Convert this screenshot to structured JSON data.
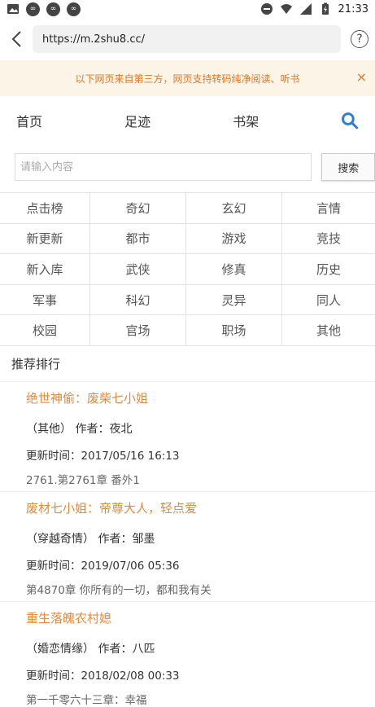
{
  "status": {
    "time": "21:33"
  },
  "browser": {
    "url": "https://m.2shu8.cc/"
  },
  "notice": {
    "text": "以下网页来自第三方，网页支持转码纯净阅读、听书",
    "close": "×"
  },
  "nav": {
    "items": [
      "首页",
      "足迹",
      "书架"
    ]
  },
  "search": {
    "placeholder": "请输入内容",
    "button": "搜索"
  },
  "categories": [
    "点击榜",
    "奇幻",
    "玄幻",
    "言情",
    "新更新",
    "都市",
    "游戏",
    "竞技",
    "新入库",
    "武侠",
    "修真",
    "历史",
    "军事",
    "科幻",
    "灵异",
    "同人",
    "校园",
    "官场",
    "职场",
    "其他"
  ],
  "recommend": {
    "header": "推荐排行",
    "books": [
      {
        "title": "绝世神偷：废柴七小姐",
        "meta": "（其他） 作者：夜北",
        "time": "更新时间：2017/05/16 16:13",
        "chapter": "2761.第2761章 番外1"
      },
      {
        "title": "废材七小姐：帝尊大人，轻点爱",
        "meta": "（穿越奇情） 作者：邹墨",
        "time": "更新时间：2019/07/06 05:36",
        "chapter": "第4870章 你所有的一切，都和我有关"
      },
      {
        "title": "重生落魄农村媳",
        "meta": "（婚恋情缘） 作者：八匹",
        "time": "更新时间：2018/02/08 00:33",
        "chapter": "第一千零六十三章：幸福"
      }
    ]
  },
  "colors": {
    "accent": "#e58a3c",
    "notice_bg": "#fdf4e8",
    "search_icon": "#2f7fd0"
  }
}
